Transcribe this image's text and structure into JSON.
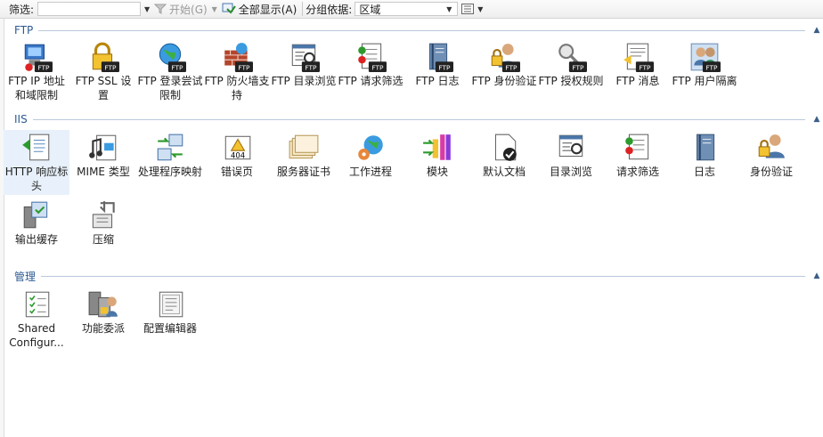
{
  "toolbar": {
    "filter_label": "筛选:",
    "start_label": "开始(G)",
    "show_all_label": "全部显示(A)",
    "group_by_label": "分组依据:",
    "group_by_value": "区域"
  },
  "sections": {
    "ftp": {
      "title": "FTP"
    },
    "iis": {
      "title": "IIS"
    },
    "manage": {
      "title": "管理"
    }
  },
  "ftp_items": [
    {
      "label": "FTP IP 地址和域限制",
      "icon": "server-restriction-icon"
    },
    {
      "label": "FTP SSL 设置",
      "icon": "lock-icon"
    },
    {
      "label": "FTP 登录尝试限制",
      "icon": "globe-icon"
    },
    {
      "label": "FTP 防火墙支持",
      "icon": "firewall-icon"
    },
    {
      "label": "FTP 目录浏览",
      "icon": "directory-browse-icon"
    },
    {
      "label": "FTP 请求筛选",
      "icon": "request-filter-icon"
    },
    {
      "label": "FTP 日志",
      "icon": "log-icon"
    },
    {
      "label": "FTP 身份验证",
      "icon": "user-lock-icon"
    },
    {
      "label": "FTP 授权规则",
      "icon": "key-icon"
    },
    {
      "label": "FTP 消息",
      "icon": "message-icon"
    },
    {
      "label": "FTP 用户隔离",
      "icon": "user-isolation-icon"
    }
  ],
  "iis_items": [
    {
      "label": "HTTP 响应标头",
      "icon": "http-headers-icon"
    },
    {
      "label": "MIME 类型",
      "icon": "mime-icon"
    },
    {
      "label": "处理程序映射",
      "icon": "handler-mapping-icon"
    },
    {
      "label": "错误页",
      "icon": "error-page-icon"
    },
    {
      "label": "服务器证书",
      "icon": "certificate-icon"
    },
    {
      "label": "工作进程",
      "icon": "worker-process-icon"
    },
    {
      "label": "模块",
      "icon": "modules-icon"
    },
    {
      "label": "默认文档",
      "icon": "default-document-icon"
    },
    {
      "label": "目录浏览",
      "icon": "directory-browse-icon"
    },
    {
      "label": "请求筛选",
      "icon": "request-filter-icon"
    },
    {
      "label": "日志",
      "icon": "log-icon"
    },
    {
      "label": "身份验证",
      "icon": "user-lock-icon"
    },
    {
      "label": "输出缓存",
      "icon": "output-cache-icon"
    },
    {
      "label": "压缩",
      "icon": "compression-icon"
    }
  ],
  "manage_items": [
    {
      "label": "Shared Configur...",
      "icon": "shared-config-icon"
    },
    {
      "label": "功能委派",
      "icon": "delegation-icon"
    },
    {
      "label": "配置编辑器",
      "icon": "config-editor-icon"
    }
  ]
}
